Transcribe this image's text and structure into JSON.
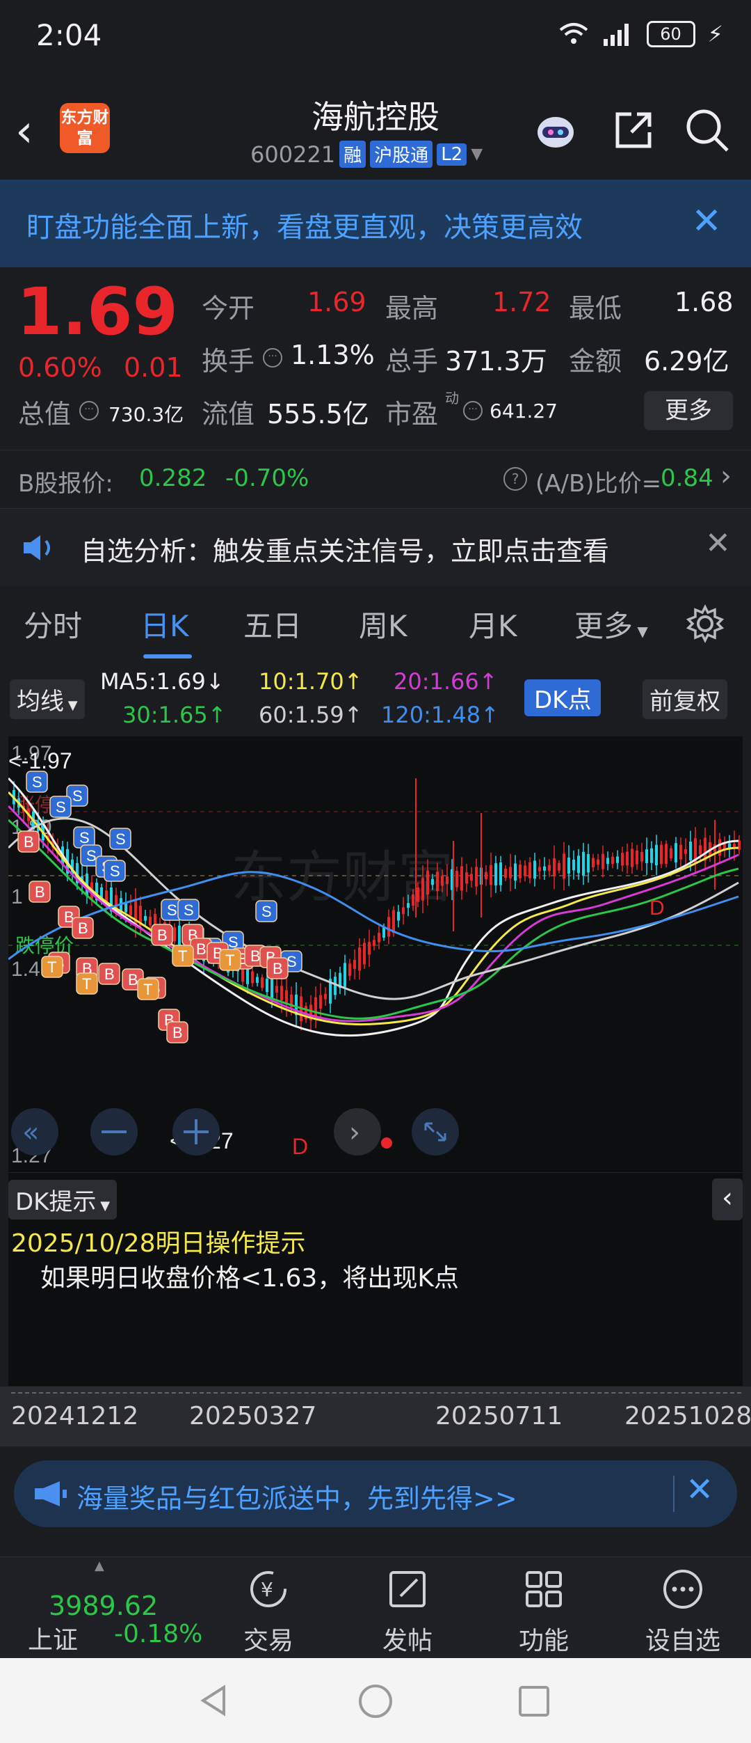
{
  "status_bar": {
    "time": "2:04",
    "battery": "60"
  },
  "header": {
    "logo_text": "东方财富",
    "stock_name": "海航控股",
    "stock_code": "600221",
    "tags": [
      "融",
      "沪股通",
      "L2"
    ]
  },
  "banner": {
    "text": "盯盘功能全面上新，看盘更直观，决策更高效"
  },
  "quote": {
    "price": "1.69",
    "change_pct": "0.60%",
    "change_abs": "0.01",
    "open_label": "今开",
    "open": "1.69",
    "high_label": "最高",
    "high": "1.72",
    "low_label": "最低",
    "low": "1.68",
    "turnover_label": "换手",
    "turnover": "1.13%",
    "volume_label": "总手",
    "volume": "371.3万",
    "amount_label": "金额",
    "amount": "6.29亿",
    "total_value_label": "总值",
    "total_value": "730.3亿",
    "float_value_label": "流值",
    "float_value": "555.5亿",
    "pe_label": "市盈",
    "pe_sup": "动",
    "pe": "641.27",
    "more_label": "更多"
  },
  "bshare": {
    "label": "B股报价:",
    "price": "0.282",
    "change": "-0.70%",
    "ratio_label": "(A/B)比价=",
    "ratio": "0.84"
  },
  "notify": {
    "text": "自选分析：触发重点关注信号，立即点击查看"
  },
  "tabs": [
    "分时",
    "日K",
    "五日",
    "周K",
    "月K",
    "更多"
  ],
  "active_tab": "日K",
  "ma": {
    "selector": "均线",
    "ma5": "MA5:1.69↓",
    "ma10": "10:1.70↑",
    "ma20": "20:1.66↑",
    "ma30": "30:1.65↑",
    "ma60": "60:1.59↑",
    "ma120": "120:1.48↑",
    "dk_button": "DK点",
    "adjust_button": "前复权"
  },
  "chart": {
    "watermark": "东方财富",
    "y_labels": [
      "1.97",
      "1.80",
      "1",
      "1.4",
      "1.27"
    ],
    "limit_up_label": "涨停价",
    "limit_down_label": "跌停价",
    "max_marker": "<-1.97",
    "min_marker": "<-1.27"
  },
  "colors": {
    "up": "#e8262b",
    "down": "#2bc64a",
    "accent": "#4a90f0",
    "ma5": "#f0f0f0",
    "ma10": "#f5e94a",
    "ma20": "#d63bd6",
    "ma30": "#2bc64a",
    "ma60": "#d0d0d0",
    "ma120": "#3f8ff0"
  },
  "dk_tip": {
    "selector": "DK提示",
    "date_line": "2025/10/28明日操作提示",
    "text": "如果明日收盘价格<1.63，将出现K点"
  },
  "dates": [
    "20241212",
    "20250327",
    "20250711",
    "20251028"
  ],
  "ad": {
    "text": "海量奖品与红包派送中，先到先得>>"
  },
  "bottom_nav": {
    "index_value": "3989.62",
    "index_name": "上证",
    "index_change": "-0.18%",
    "items": [
      "交易",
      "发帖",
      "功能",
      "设自选"
    ]
  }
}
